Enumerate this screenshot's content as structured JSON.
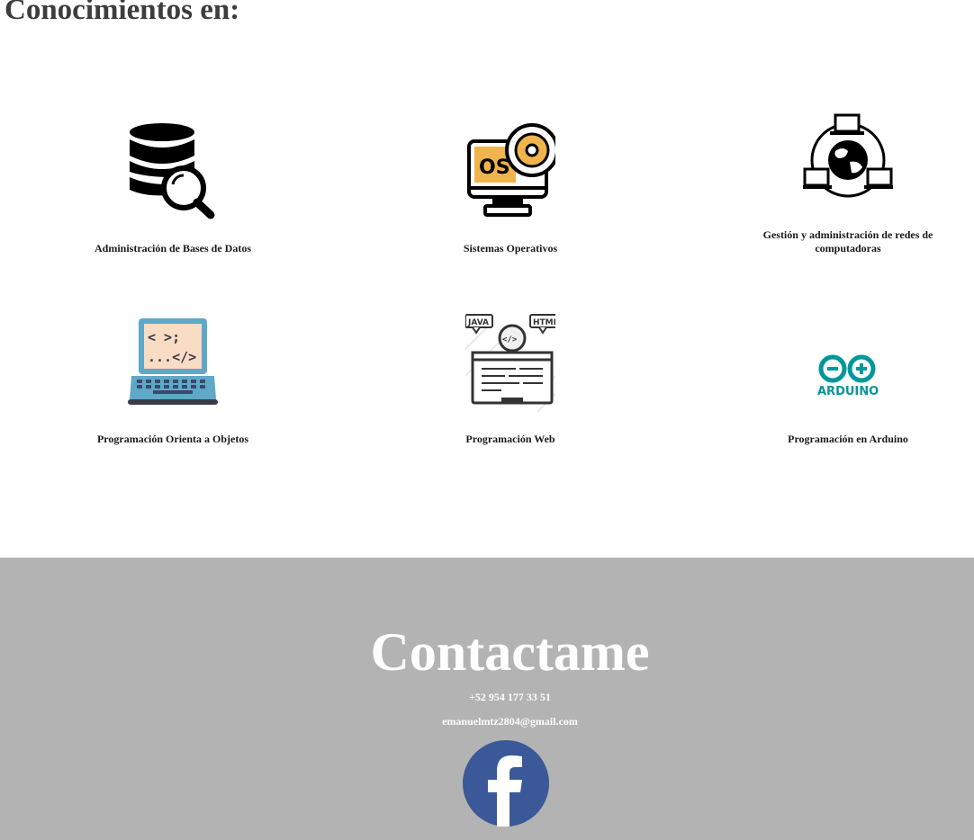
{
  "section": {
    "title": "Conocimientos en:"
  },
  "skills": [
    {
      "label": "Administración de Bases de Datos",
      "icon": "database-search-icon"
    },
    {
      "label": "Sistemas Operativos",
      "icon": "operating-system-icon"
    },
    {
      "label": "Gestión y administración de redes de computadoras",
      "icon": "network-globe-icon"
    },
    {
      "label": "Programación Orienta a Objetos",
      "icon": "laptop-code-icon"
    },
    {
      "label": "Programación Web",
      "icon": "web-programming-icon"
    },
    {
      "label": "Programación en Arduino",
      "icon": "arduino-logo",
      "logo_text": "ARDUINO"
    }
  ],
  "contact": {
    "title": "Contactame",
    "phone": "+52 954 177 33 51",
    "email": "emanuelmtz2804@gmail.com",
    "facebook_icon": "facebook-icon"
  },
  "colors": {
    "heading": "#3d3d3d",
    "footer_bg": "#b3b3b3",
    "facebook_blue": "#3b5998",
    "arduino_teal": "#00979c",
    "os_orange": "#f0b44c",
    "laptop_blue": "#5fa8c9"
  },
  "code_glyphs": {
    "os_badge": "OS",
    "java_tag": "JAVA",
    "html_tag": "HTML",
    "code_tag": "</>",
    "laptop_line1": "< >;",
    "laptop_line2": "...</>"
  }
}
